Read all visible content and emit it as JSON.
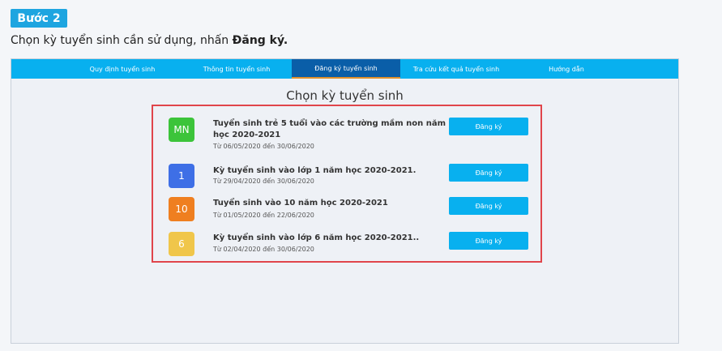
{
  "step": {
    "label": "Bước 2"
  },
  "instruction": {
    "prefix": "Chọn kỳ tuyển sinh cần sử dụng, nhấn ",
    "bold": "Đăng ký."
  },
  "nav": {
    "items": [
      {
        "label": "Quy định tuyển sinh",
        "active": false
      },
      {
        "label": "Thông tin tuyển sinh",
        "active": false
      },
      {
        "label": "Đăng ký tuyển sinh",
        "active": true
      },
      {
        "label": "Tra cứu kết quả tuyển sinh",
        "active": false
      },
      {
        "label": "Hướng dẫn",
        "active": false
      }
    ]
  },
  "main": {
    "title": "Chọn kỳ tuyển sinh",
    "rows": [
      {
        "icon_text": "MN",
        "icon_color": "#3cc43a",
        "title": "Tuyển sinh trẻ 5 tuổi vào các trường mầm non năm học 2020-2021",
        "date": "Từ 06/05/2020 đến 30/06/2020",
        "button": "Đăng ký"
      },
      {
        "icon_text": "1",
        "icon_color": "#3e6fe6",
        "title": "Kỳ tuyển sinh vào lớp 1 năm học 2020-2021.",
        "date": "Từ 29/04/2020 đến 30/06/2020",
        "button": "Đăng ký"
      },
      {
        "icon_text": "10",
        "icon_color": "#ef7f20",
        "title": "Tuyển sinh vào 10 năm học 2020-2021",
        "date": "Từ 01/05/2020 đến 22/06/2020",
        "button": "Đăng ký"
      },
      {
        "icon_text": "6",
        "icon_color": "#f0c64a",
        "title": "Kỳ tuyển sinh vào lớp 6 năm học 2020-2021..",
        "date": "Từ 02/04/2020 đến 30/06/2020",
        "button": "Đăng ký"
      }
    ]
  },
  "colors": {
    "accent": "#08b0ef",
    "active_tab": "#0a5ea8",
    "highlight_border": "#e0454b"
  }
}
